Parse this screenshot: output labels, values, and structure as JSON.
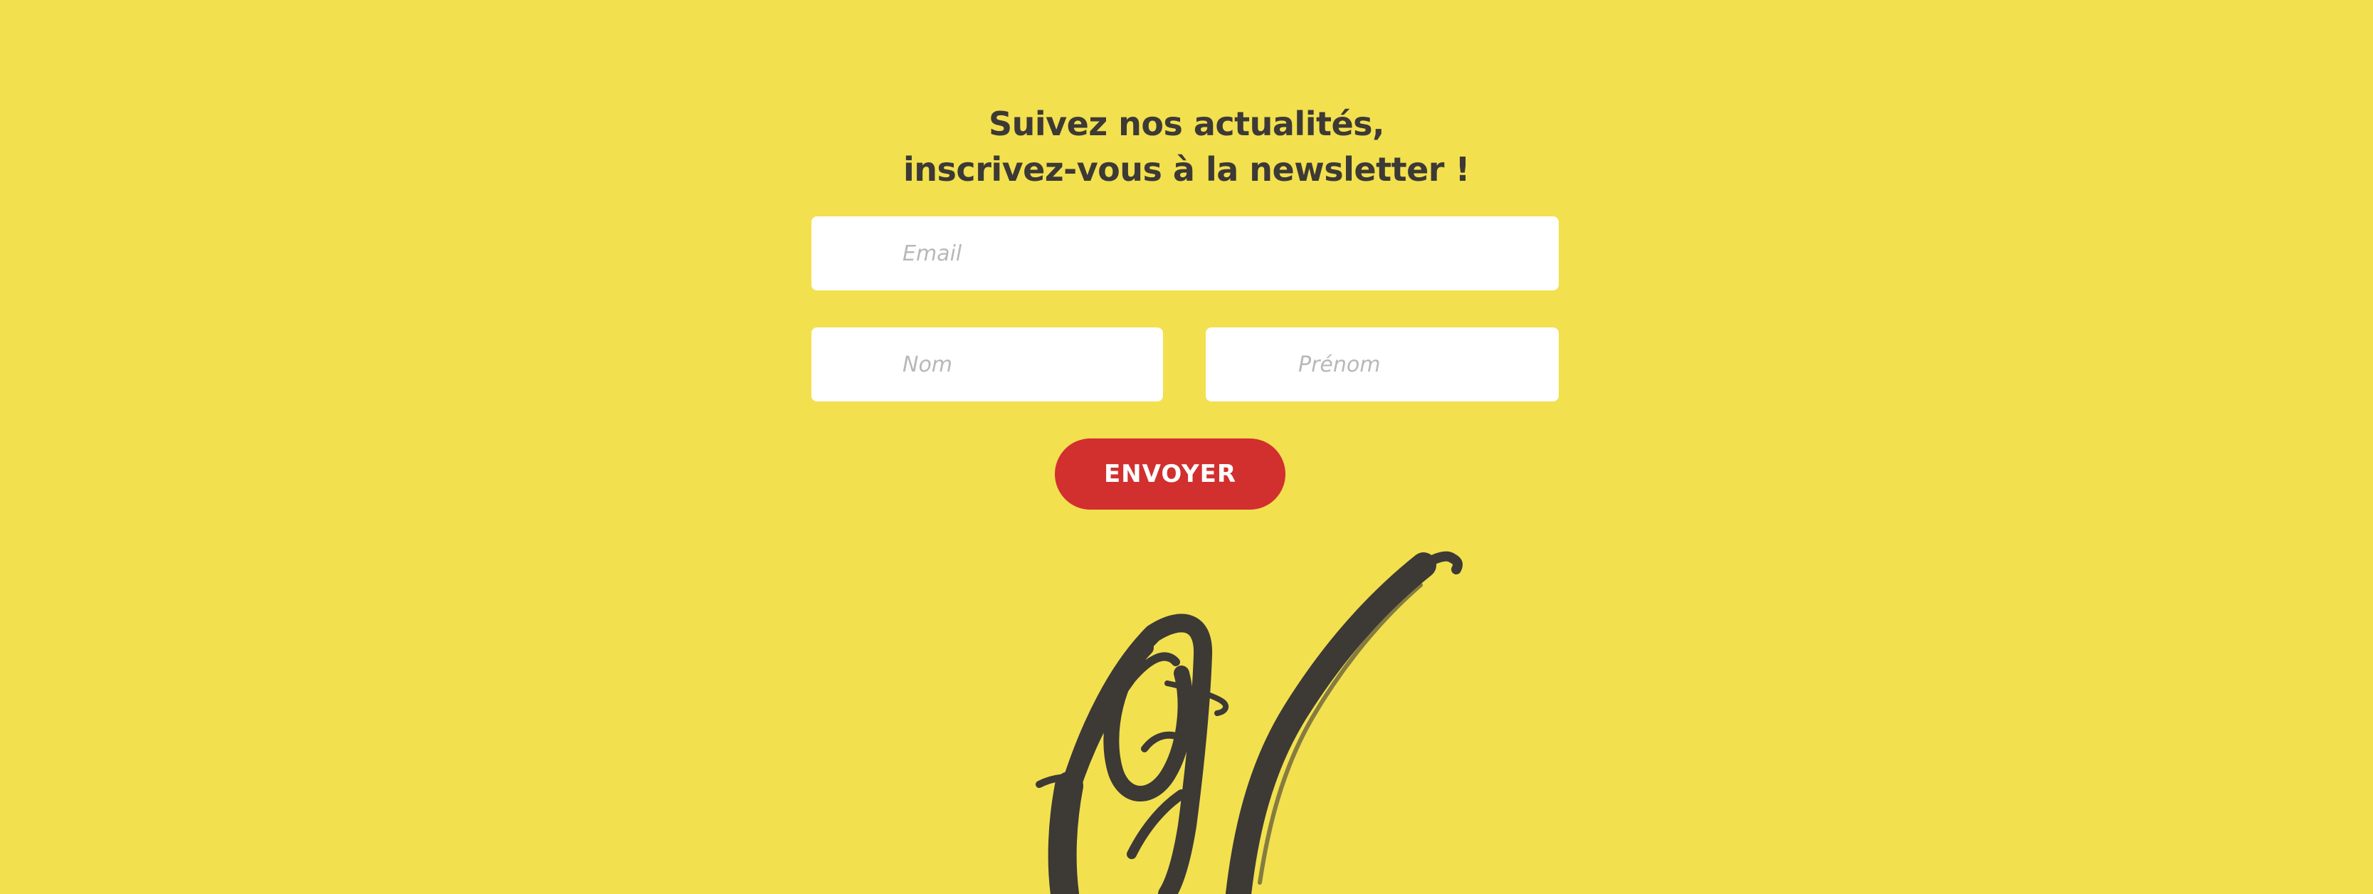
{
  "newsletter": {
    "title_line1": "Suivez nos actualités,",
    "title_line2": "inscrivez-vous à la newsletter !"
  },
  "form": {
    "email_placeholder": "Email",
    "nom_placeholder": "Nom",
    "prenom_placeholder": "Prénom",
    "submit_label": "ENVOYER"
  },
  "colors": {
    "background": "#f2e04f",
    "text": "#3d3935",
    "button": "#d22f2f",
    "input": "#ffffff"
  },
  "logo": {
    "icon": "brush-script-logo"
  }
}
